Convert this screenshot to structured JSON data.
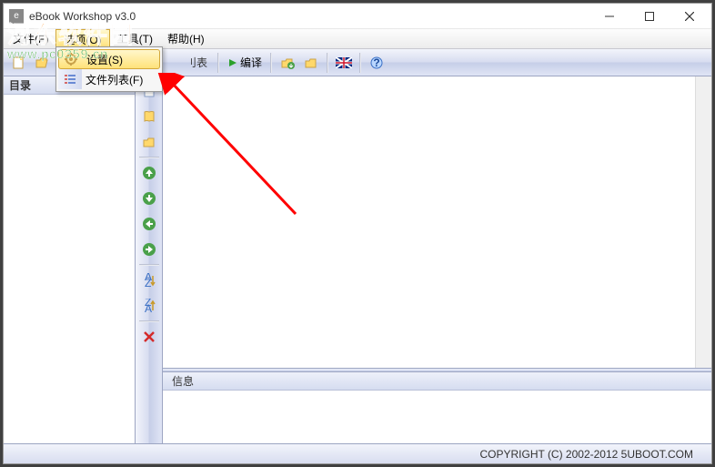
{
  "window": {
    "title": "eBook Workshop v3.0",
    "icon_letter": "e"
  },
  "menubar": {
    "items": [
      {
        "label": "文件(F)"
      },
      {
        "label": "选项(O)"
      },
      {
        "label": "工具(T)"
      },
      {
        "label": "帮助(H)"
      }
    ],
    "open_index": 1
  },
  "dropdown": {
    "items": [
      {
        "label": "设置(S)",
        "icon": "gear",
        "highlight": true
      },
      {
        "label": "文件列表(F)",
        "icon": "list",
        "highlight": false
      }
    ]
  },
  "toolbar": {
    "compile_label": "编译",
    "list_suffix": "刂表"
  },
  "left_panel": {
    "header": "目录"
  },
  "info_panel": {
    "header": "信息"
  },
  "statusbar": {
    "copyright": "COPYRIGHT (C) 2002-2012 5UBOOT.COM"
  },
  "watermark": {
    "cn": "河东软件园",
    "url": "www.pc0359.cn"
  },
  "colors": {
    "accent_gradient_top": "#f2f4fb",
    "accent_gradient_bottom": "#c6cee8",
    "highlight": "#ffe27a",
    "arrow": "#ff0000"
  }
}
